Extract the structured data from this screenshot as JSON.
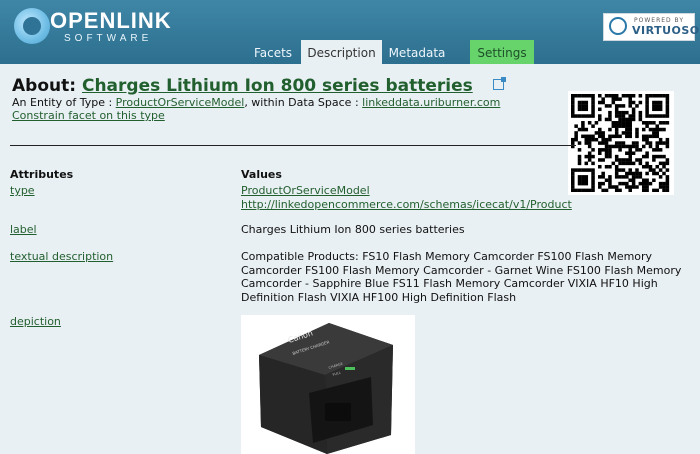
{
  "brand": {
    "name": "OPENLINK",
    "sub": "SOFTWARE"
  },
  "badge": {
    "top": "POWERED BY",
    "name": "VIRTUOSO"
  },
  "tabs": [
    {
      "label": "Facets"
    },
    {
      "label": "Description",
      "active": true
    },
    {
      "label": "Metadata"
    },
    {
      "label": "Settings"
    }
  ],
  "about": {
    "prefix": "About:",
    "title": "Charges Lithium Ion 800 series batteries",
    "type_prefix": "An Entity of Type : ",
    "type_link": "ProductOrServiceModel",
    "space_prefix": ", within Data Space : ",
    "space_link": "linkeddata.uriburner.com",
    "constrain": "Constrain facet on this type"
  },
  "table": {
    "headers": {
      "attributes": "Attributes",
      "values": "Values"
    },
    "rows": [
      {
        "attr": "type",
        "values": [
          "ProductOrServiceModel",
          "http://linkedopencommerce.com/schemas/icecat/v1/Product"
        ]
      },
      {
        "attr": "label",
        "values": [
          "Charges Lithium Ion 800 series batteries"
        ]
      },
      {
        "attr": "textual description",
        "values": [
          "Compatible Products: FS10 Flash Memory Camcorder FS100 Flash Memory Camcorder FS100 Flash Memory Camcorder - Garnet Wine FS100 Flash Memory Camcorder - Sapphire Blue FS11 Flash Memory Camcorder VIXIA HF10 High Definition Flash VIXIA HF100 High Definition Flash"
        ]
      },
      {
        "attr": "depiction",
        "values": []
      }
    ]
  },
  "product_image": {
    "brand": "Canon",
    "model": "BATTERY CHARGER",
    "charge": "CHARGE",
    "full": "FULL"
  },
  "icons": [
    "external-link-icon",
    "qr-code-icon",
    "virtuoso-logo-icon",
    "openlink-logo-icon"
  ]
}
